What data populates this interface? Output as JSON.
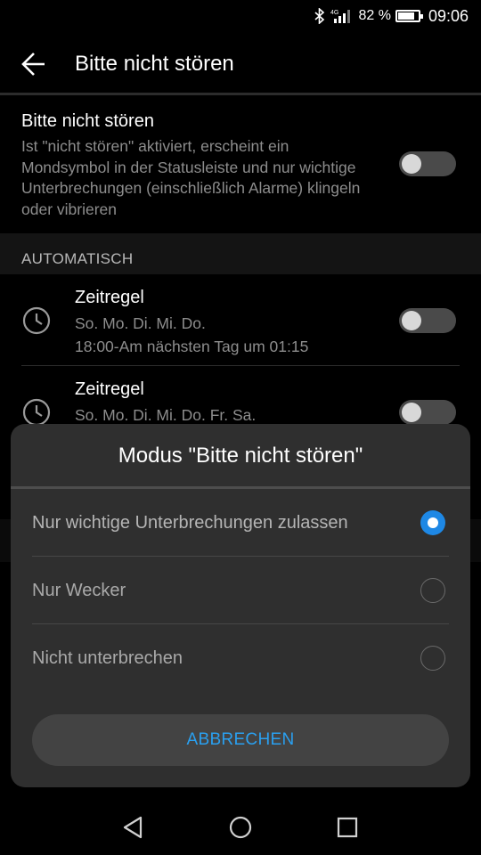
{
  "status_bar": {
    "network": "4G",
    "battery_text": "82 %",
    "battery_level": 0.82,
    "time": "09:06"
  },
  "app_bar": {
    "title": "Bitte nicht stören",
    "back_icon": "arrow-left-icon"
  },
  "dnd": {
    "title": "Bitte nicht stören",
    "description": "Ist \"nicht stören\" aktiviert, erscheint ein Mondsymbol in der Statusleiste und nur wichtige Unterbrechungen (einschließlich Alarme) klingeln oder vibrieren",
    "enabled": false
  },
  "automatic": {
    "header": "AUTOMATISCH",
    "rules": [
      {
        "title": "Zeitregel",
        "days": "So. Mo. Di. Mi. Do.",
        "time": "18:00-Am nächsten Tag um 01:15",
        "enabled": false,
        "icon": "clock-icon"
      },
      {
        "title": "Zeitregel",
        "days": "So. Mo. Di. Mi. Do. Fr. Sa.",
        "enabled": false,
        "icon": "clock-icon"
      }
    ]
  },
  "dialog": {
    "title": "Modus \"Bitte nicht stören\"",
    "options": [
      {
        "label": "Nur wichtige Unterbrechungen zulassen",
        "selected": true
      },
      {
        "label": "Nur Wecker",
        "selected": false
      },
      {
        "label": "Nicht unterbrechen",
        "selected": false
      }
    ],
    "cancel_label": "ABBRECHEN",
    "accent_color": "#1e88e5"
  },
  "nav_bar": {
    "icons": [
      "back-triangle-icon",
      "home-circle-icon",
      "recents-square-icon"
    ]
  }
}
